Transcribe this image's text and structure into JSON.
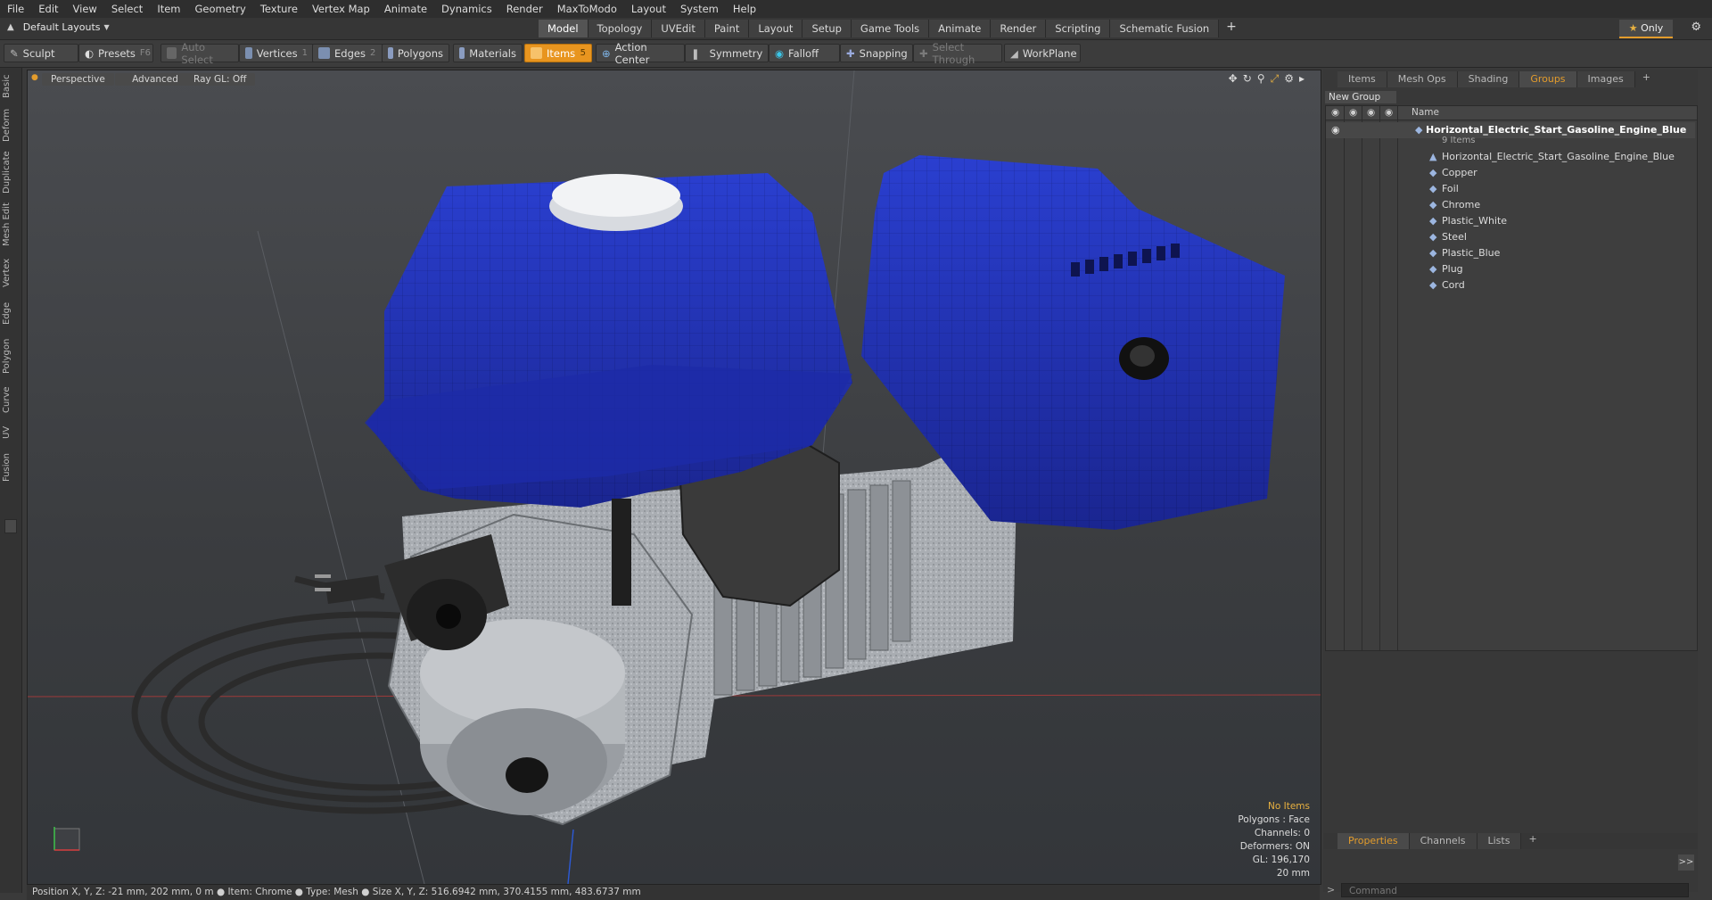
{
  "menubar": [
    "File",
    "Edit",
    "View",
    "Select",
    "Item",
    "Geometry",
    "Texture",
    "Vertex Map",
    "Animate",
    "Dynamics",
    "Render",
    "MaxToModo",
    "Layout",
    "System",
    "Help"
  ],
  "layoutbar": {
    "layout_label": "Default Layouts",
    "tabs": [
      "Model",
      "Topology",
      "UVEdit",
      "Paint",
      "Layout",
      "Setup",
      "Game Tools",
      "Animate",
      "Render",
      "Scripting",
      "Schematic Fusion"
    ],
    "active_tab": "Model",
    "add_label": "+",
    "only_label": "Only"
  },
  "toolbar": {
    "sculpt": "Sculpt",
    "presets": "Presets",
    "presets_shortcut": "F6",
    "auto_select": "Auto Select",
    "vertices": "Vertices",
    "vertices_shortcut": "1",
    "edges": "Edges",
    "edges_shortcut": "2",
    "polygons": "Polygons",
    "materials": "Materials",
    "items": "Items",
    "items_shortcut": "5",
    "action_center": "Action Center",
    "symmetry": "Symmetry",
    "falloff": "Falloff",
    "snapping": "Snapping",
    "select_through": "Select Through",
    "workplane": "WorkPlane"
  },
  "left_tabs": [
    "Basic",
    "Deform",
    "Duplicate",
    "Mesh Edit",
    "Vertex",
    "Edge",
    "Polygon",
    "Curve",
    "UV",
    "Fusion"
  ],
  "viewport": {
    "view_mode": "Perspective",
    "shading": "Advanced",
    "raygl": "Ray GL: Off",
    "stats": {
      "no_items": "No Items",
      "polygons": "Polygons : Face",
      "channels": "Channels: 0",
      "deformers": "Deformers: ON",
      "gl": "GL: 196,170",
      "unit": "20 mm"
    }
  },
  "right_panel": {
    "tabs": [
      "Items",
      "Mesh Ops",
      "Shading",
      "Groups",
      "Images"
    ],
    "active_tab": "Groups",
    "new_group": "New Group",
    "name_header": "Name",
    "group_name": "Horizontal_Electric_Start_Gasoline_Engine_Blue",
    "group_count": "9 Items",
    "items": [
      "Horizontal_Electric_Start_Gasoline_Engine_Blue",
      "Copper",
      "Foil",
      "Chrome",
      "Plastic_White",
      "Steel",
      "Plastic_Blue",
      "Plug",
      "Cord"
    ],
    "bottom_tabs": [
      "Properties",
      "Channels",
      "Lists"
    ],
    "active_bottom_tab": "Properties",
    "command_placeholder": "Command"
  },
  "statusbar": {
    "text": "Position X, Y, Z:  -21 mm, 202 mm, 0 m ● Item:  Chrome ●  Type:  Mesh ● Size X, Y, Z:   516.6942 mm, 370.4155 mm, 483.6737 mm"
  },
  "colors": {
    "accent": "#e8951f",
    "engine_blue": "#1f2fb0",
    "viewport_bg": "#3e4044"
  }
}
